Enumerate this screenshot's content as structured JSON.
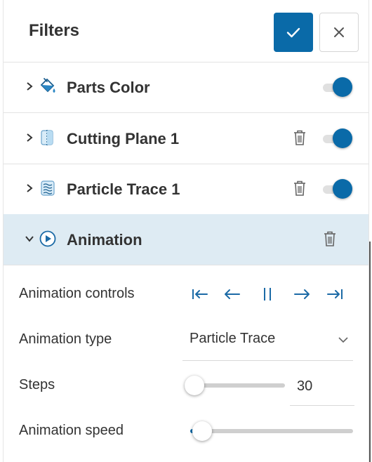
{
  "header": {
    "title": "Filters",
    "confirm_icon": "check-icon",
    "close_icon": "close-icon"
  },
  "filters": [
    {
      "label": "Parts Color",
      "icon": "paint-bucket-icon",
      "enabled": true,
      "deletable": false,
      "expanded": false
    },
    {
      "label": "Cutting Plane 1",
      "icon": "cutting-plane-icon",
      "enabled": true,
      "deletable": true,
      "expanded": false
    },
    {
      "label": "Particle Trace 1",
      "icon": "particle-trace-icon",
      "enabled": true,
      "deletable": true,
      "expanded": false
    },
    {
      "label": "Animation",
      "icon": "play-circle-icon",
      "deletable": true,
      "expanded": true
    }
  ],
  "animation": {
    "controls_label": "Animation controls",
    "controls": [
      "skip-to-start-icon",
      "step-back-icon",
      "pause-icon",
      "step-forward-icon",
      "skip-to-end-icon"
    ],
    "type_label": "Animation type",
    "type_value": "Particle Trace",
    "steps_label": "Steps",
    "steps_value": "30",
    "speed_label": "Animation speed"
  },
  "colors": {
    "accent": "#0a6aa8",
    "active_row_bg": "#deebf3"
  }
}
